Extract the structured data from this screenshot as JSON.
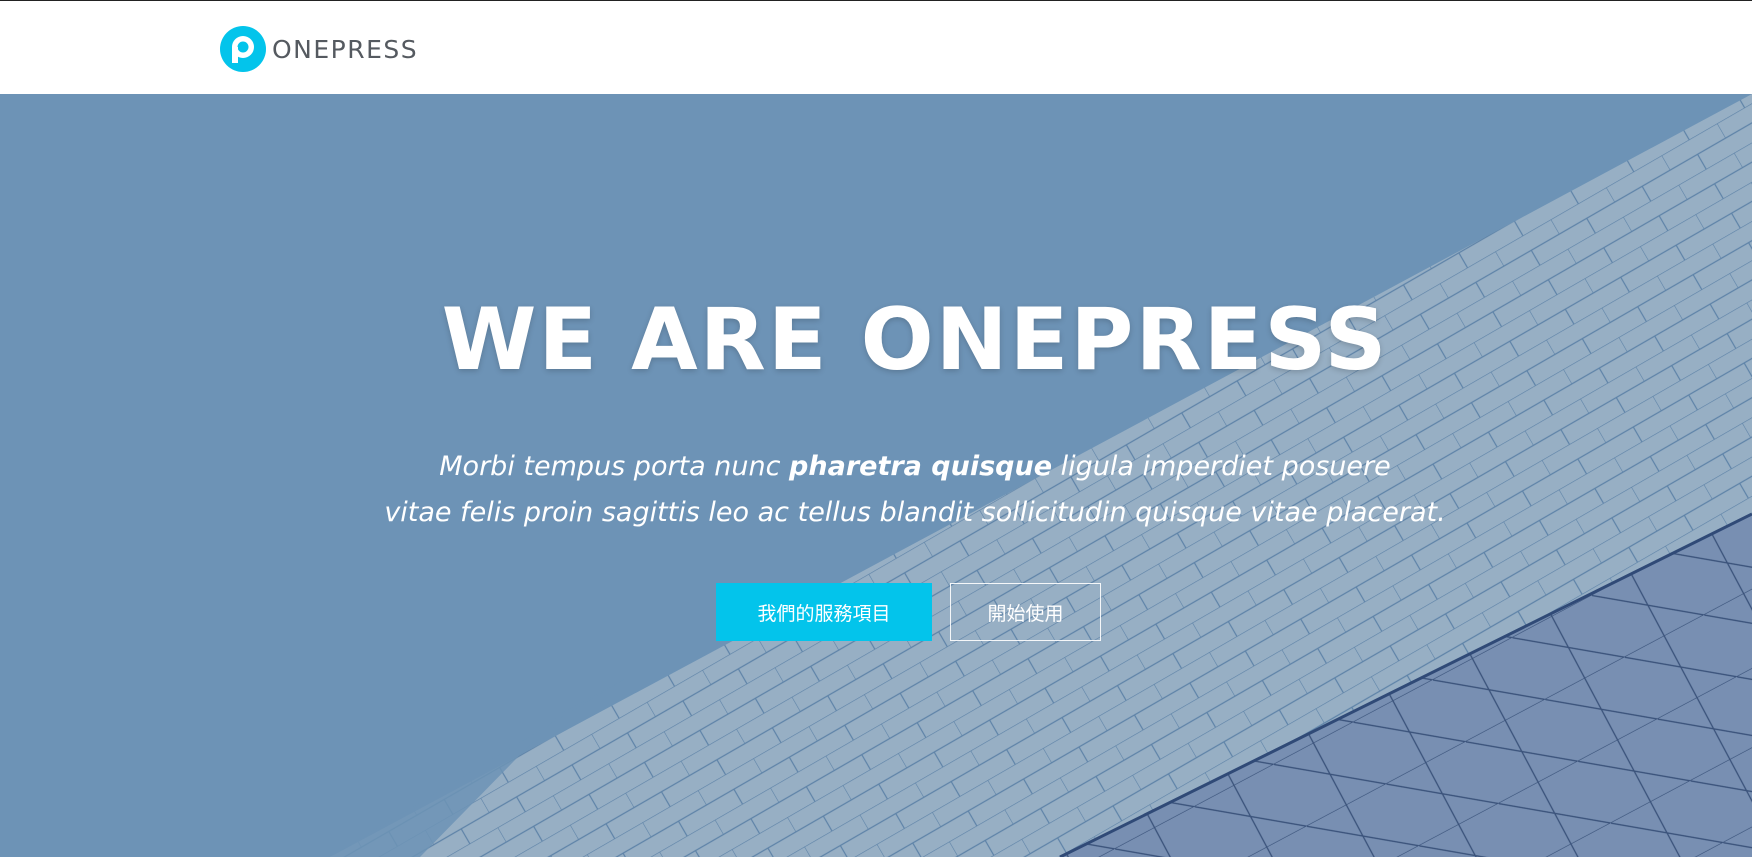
{
  "header": {
    "logo_text": "ONEPRESS",
    "logo_icon": "onepress-p-logo-icon"
  },
  "hero": {
    "title": "WE ARE ONEPRESS",
    "subtitle_line1_part1": "Morbi tempus porta nunc ",
    "subtitle_line1_bold": "pharetra quisque",
    "subtitle_line1_part2": " ligula imperdiet posuere",
    "subtitle_line2": "vitae felis proin sagittis leo ac tellus blandit sollicitudin quisque vitae placerat.",
    "primary_button_label": "我們的服務項目",
    "secondary_button_label": "開始使用"
  },
  "colors": {
    "accent": "#03c4eb",
    "hero_overlay": "#6d93b6",
    "logo_text": "#555a60"
  }
}
